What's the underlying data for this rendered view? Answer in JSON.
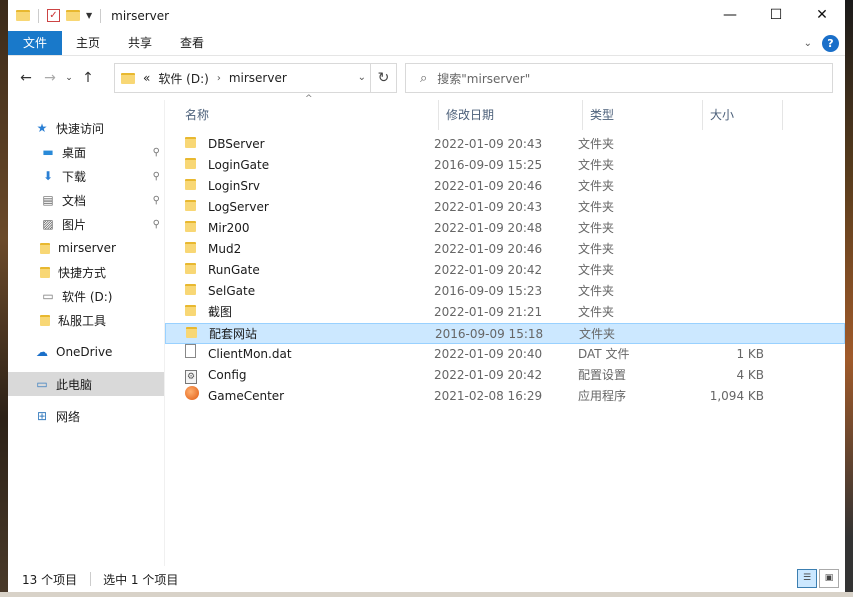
{
  "window": {
    "title": "mirserver"
  },
  "ribbon": {
    "tabs": [
      "文件",
      "主页",
      "共享",
      "查看"
    ]
  },
  "address": {
    "prefix": "«",
    "drive": "软件 (D:)",
    "folder": "mirserver"
  },
  "search": {
    "placeholder": "搜索\"mirserver\""
  },
  "nav": {
    "quick_access": "快速访问",
    "items": [
      {
        "label": "桌面",
        "icon": "desktop-icon",
        "pinned": true
      },
      {
        "label": "下载",
        "icon": "download-icon",
        "pinned": true
      },
      {
        "label": "文档",
        "icon": "document-icon",
        "pinned": true
      },
      {
        "label": "图片",
        "icon": "picture-icon",
        "pinned": true
      },
      {
        "label": "mirserver",
        "icon": "folder-icon",
        "pinned": false
      },
      {
        "label": "快捷方式",
        "icon": "folder-icon",
        "pinned": false
      },
      {
        "label": "软件 (D:)",
        "icon": "drive-icon",
        "pinned": false
      },
      {
        "label": "私服工具",
        "icon": "folder-icon",
        "pinned": false
      }
    ],
    "onedrive": "OneDrive",
    "this_pc": "此电脑",
    "network": "网络"
  },
  "columns": {
    "name": "名称",
    "date": "修改日期",
    "type": "类型",
    "size": "大小"
  },
  "files": [
    {
      "name": "DBServer",
      "date": "2022-01-09 20:43",
      "type": "文件夹",
      "size": "",
      "icon": "folder"
    },
    {
      "name": "LoginGate",
      "date": "2016-09-09 15:25",
      "type": "文件夹",
      "size": "",
      "icon": "folder"
    },
    {
      "name": "LoginSrv",
      "date": "2022-01-09 20:46",
      "type": "文件夹",
      "size": "",
      "icon": "folder"
    },
    {
      "name": "LogServer",
      "date": "2022-01-09 20:43",
      "type": "文件夹",
      "size": "",
      "icon": "folder"
    },
    {
      "name": "Mir200",
      "date": "2022-01-09 20:48",
      "type": "文件夹",
      "size": "",
      "icon": "folder"
    },
    {
      "name": "Mud2",
      "date": "2022-01-09 20:46",
      "type": "文件夹",
      "size": "",
      "icon": "folder"
    },
    {
      "name": "RunGate",
      "date": "2022-01-09 20:42",
      "type": "文件夹",
      "size": "",
      "icon": "folder"
    },
    {
      "name": "SelGate",
      "date": "2016-09-09 15:23",
      "type": "文件夹",
      "size": "",
      "icon": "folder"
    },
    {
      "name": "截图",
      "date": "2022-01-09 21:21",
      "type": "文件夹",
      "size": "",
      "icon": "folder"
    },
    {
      "name": "配套网站",
      "date": "2016-09-09 15:18",
      "type": "文件夹",
      "size": "",
      "icon": "folder",
      "selected": true
    },
    {
      "name": "ClientMon.dat",
      "date": "2022-01-09 20:40",
      "type": "DAT 文件",
      "size": "1 KB",
      "icon": "file"
    },
    {
      "name": "Config",
      "date": "2022-01-09 20:42",
      "type": "配置设置",
      "size": "4 KB",
      "icon": "config"
    },
    {
      "name": "GameCenter",
      "date": "2021-02-08 16:29",
      "type": "应用程序",
      "size": "1,094 KB",
      "icon": "app"
    }
  ],
  "status": {
    "count": "13 个项目",
    "selection": "选中 1 个项目"
  },
  "colors": {
    "accent": "#1979ca",
    "selection": "#cce8ff",
    "folder": "#f8d775"
  }
}
